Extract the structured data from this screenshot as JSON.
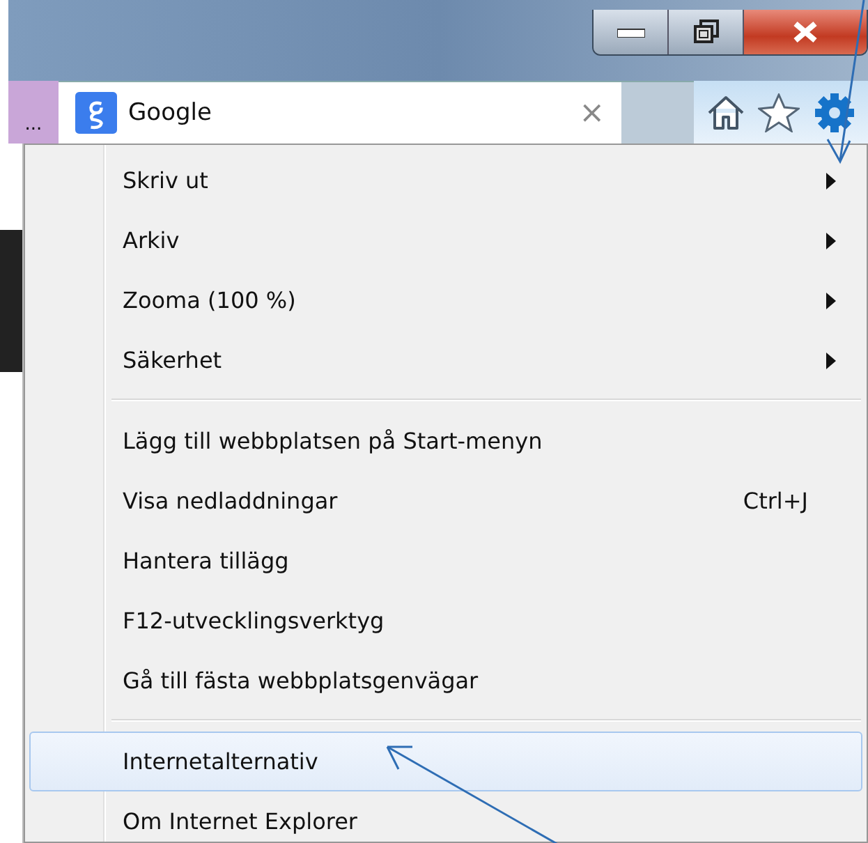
{
  "tab": {
    "ellipsis": "...",
    "title": "Google",
    "close": "×"
  },
  "menu": {
    "groups": [
      [
        {
          "label": "Skriv ut",
          "submenu": true,
          "selected": false
        },
        {
          "label": "Arkiv",
          "submenu": true,
          "selected": false
        },
        {
          "label": "Zooma (100 %)",
          "submenu": true,
          "selected": false
        },
        {
          "label": "Säkerhet",
          "submenu": true,
          "selected": false
        }
      ],
      [
        {
          "label": "Lägg till webbplatsen på Start-menyn",
          "submenu": false,
          "selected": false
        },
        {
          "label": "Visa nedladdningar",
          "shortcut": "Ctrl+J",
          "submenu": false,
          "selected": false
        },
        {
          "label": "Hantera tillägg",
          "submenu": false,
          "selected": false
        },
        {
          "label": "F12-utvecklingsverktyg",
          "submenu": false,
          "selected": false
        },
        {
          "label": "Gå till fästa webbplatsgenvägar",
          "submenu": false,
          "selected": false
        }
      ],
      [
        {
          "label": "Internetalternativ",
          "submenu": false,
          "selected": true
        },
        {
          "label": "Om Internet Explorer",
          "submenu": false,
          "selected": false
        }
      ]
    ]
  }
}
